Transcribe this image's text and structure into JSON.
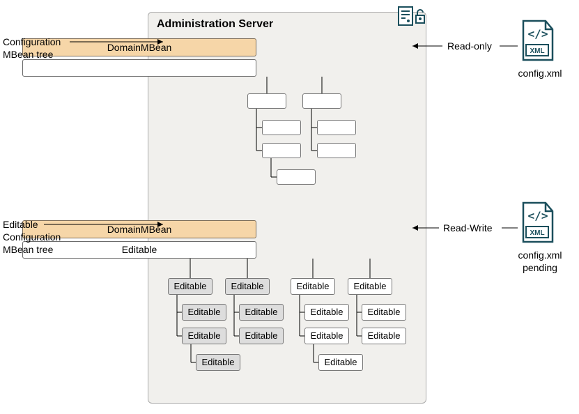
{
  "admin_server": {
    "title": "Administration Server"
  },
  "labels": {
    "config_tree": "Configuration\nMBean tree",
    "editable_tree": "Editable\nConfiguration\nMBean tree",
    "read_only": "Read-only",
    "read_write": "Read-Write",
    "config_xml": "config.xml",
    "config_xml_pending": "config.xml\npending"
  },
  "tree1": {
    "root": "DomainMBean",
    "sub": ""
  },
  "tree2": {
    "root": "DomainMBean",
    "sub": "Editable",
    "node": "Editable"
  },
  "icons": {
    "server": "server-icon",
    "xml_file": "xml-file-icon"
  }
}
